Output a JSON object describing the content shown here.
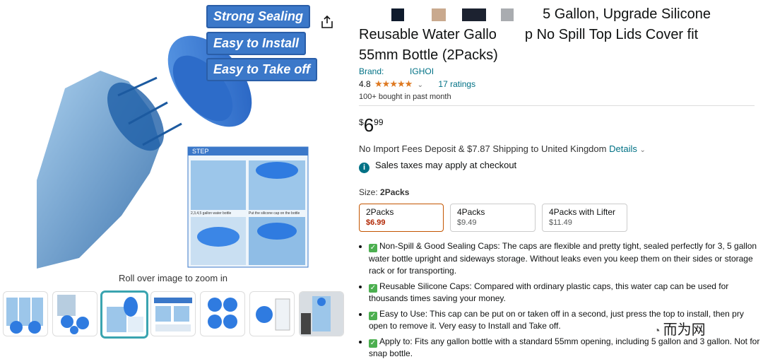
{
  "image": {
    "labels": [
      "Strong Sealing",
      "Easy to Install",
      "Easy to Take off"
    ],
    "step_title": "STEP",
    "step_captions": [
      "2,3,4,5 gallon water bottle",
      "Put the silicone cap on the bottle"
    ],
    "zoom_hint": "Roll over image to zoom in",
    "thumbnail_count": 7,
    "selected_thumbnail": 3
  },
  "product": {
    "title": "5 Gallon, Upgrade Silicone Reusable Water Gallo p No Spill Top Lids Cover fit 55mm Bottle (2Packs)",
    "title_line1": "5 Gallon, Upgrade Silicone",
    "title_line2a": "Reusable Water Gallo",
    "title_line2b": "p No Spill Top Lids Cover fit",
    "title_line3": "55mm Bottle (2Packs)",
    "brand_label": "Brand:",
    "brand_value": "IGHOI",
    "rating_value": "4.8",
    "ratings_count": "17 ratings",
    "bought": "100+ bought in past month",
    "price_symbol": "$",
    "price_whole": "6",
    "price_fraction": "99",
    "shipping_text": "No Import Fees Deposit & $7.87 Shipping to United Kingdom",
    "shipping_link": "Details",
    "tax_text": "Sales taxes may apply at checkout",
    "size_label": "Size:",
    "size_selected": "2Packs",
    "sizes": [
      {
        "name": "2Packs",
        "price": "$6.99"
      },
      {
        "name": "4Packs",
        "price": "$9.49"
      },
      {
        "name": "4Packs with Lifter",
        "price": "$11.49"
      }
    ],
    "bullets": [
      "Non-Spill & Good Sealing Caps: The caps are flexible and pretty tight, sealed perfectly for 3, 5 gallon water bottle upright and sideways storage. Without leaks even you keep them on their sides or storage rack or for transporting.",
      "Reusable Silicone Caps: Compared with ordinary plastic caps, this water cap can be used for thousands times saving your money.",
      "Easy to Use: This cap can be put on or taken off in a second, just press the top to install, then pry open to remove it. Very easy to Install and Take off.",
      "Apply to: Fits any gallon bottle with a standard 55mm opening, including 5 gallon and 3 gallon. Not for snap bottle."
    ]
  },
  "watermark": "而为网",
  "colors": {
    "link": "#007185",
    "accent_selected": "#c45500",
    "price_red": "#b12704",
    "star": "#de7921",
    "cap_blue": "#3b78c9"
  }
}
